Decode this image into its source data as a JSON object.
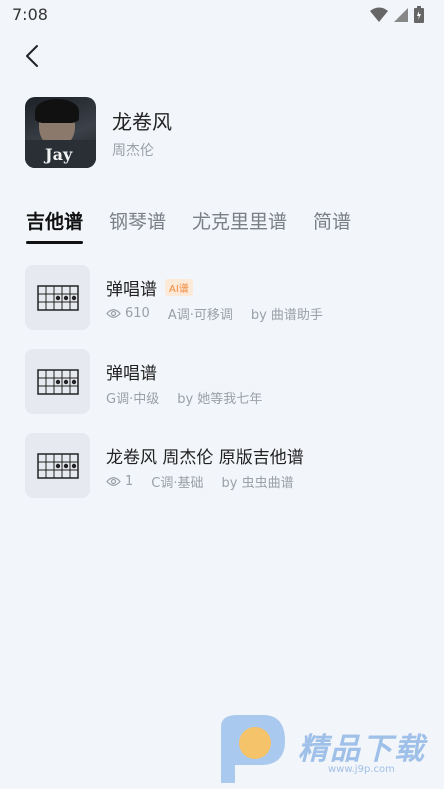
{
  "status_bar": {
    "time": "7:08"
  },
  "song": {
    "title": "龙卷风",
    "artist": "周杰伦",
    "cover_text": "Jay"
  },
  "tabs": [
    "吉他谱",
    "钢琴谱",
    "尤克里里谱",
    "简谱"
  ],
  "active_tab": 0,
  "items": [
    {
      "title": "弹唱谱",
      "badge": "AI谱",
      "views": "610",
      "key": "A调·可移调",
      "author": "by 曲谱助手"
    },
    {
      "title": "弹唱谱",
      "badge": "",
      "views": "",
      "key": "G调·中级",
      "author": "by 她等我七年"
    },
    {
      "title": "龙卷风 周杰伦 原版吉他谱",
      "badge": "",
      "views": "1",
      "key": "C调·基础",
      "author": "by 虫虫曲谱"
    }
  ],
  "watermark": {
    "text": "精品下载",
    "url": "www.j9p.com"
  },
  "colors": {
    "background": "#f2f5f9",
    "badge": "#f08a3c",
    "watermark": "#9fc0e8"
  }
}
